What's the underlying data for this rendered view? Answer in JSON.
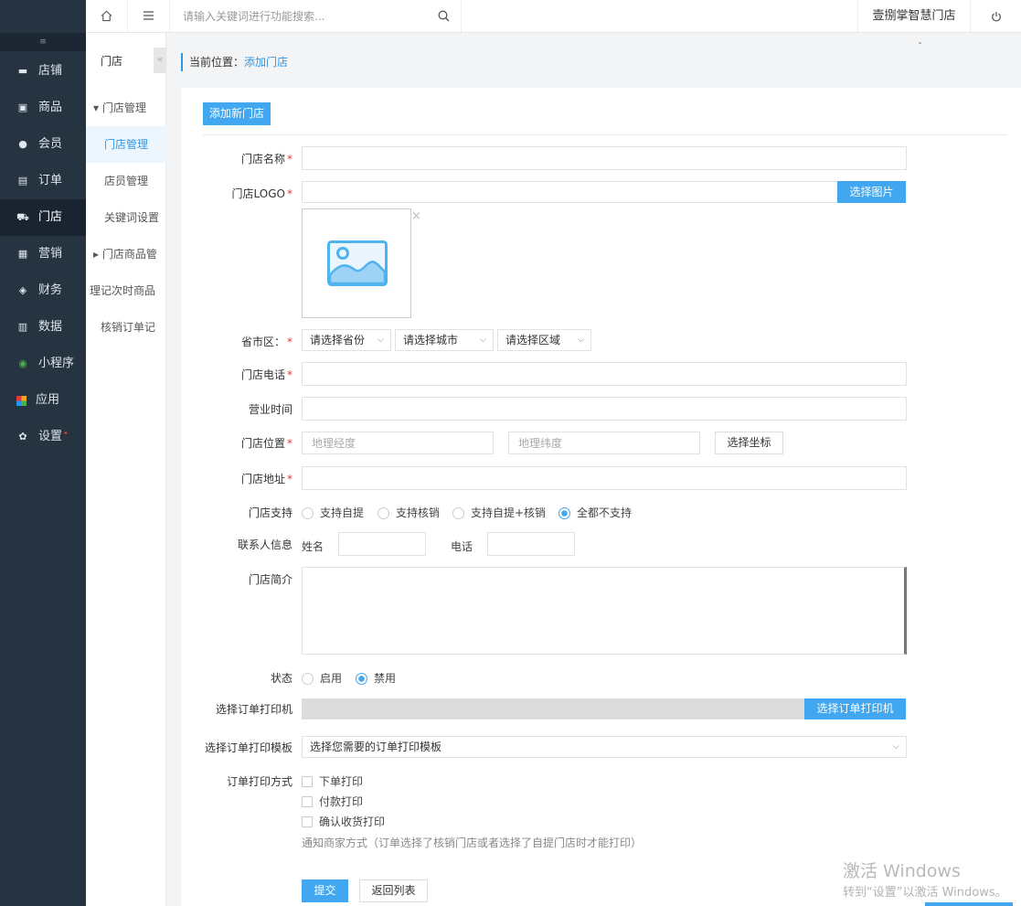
{
  "sidebar": {
    "collapse_icon": "collapse-icon",
    "items": [
      {
        "label": "店铺",
        "icon": "store-icon",
        "active": false
      },
      {
        "label": "商品",
        "icon": "goods-icon",
        "active": false
      },
      {
        "label": "会员",
        "icon": "member-icon",
        "active": false
      },
      {
        "label": "订单",
        "icon": "order-icon",
        "active": false
      },
      {
        "label": "门店",
        "icon": "shop-icon",
        "active": true
      },
      {
        "label": "营销",
        "icon": "gift-icon",
        "active": false
      },
      {
        "label": "财务",
        "icon": "money-bag-icon",
        "active": false
      },
      {
        "label": "数据",
        "icon": "bar-chart-icon",
        "active": false
      },
      {
        "label": "小程序",
        "icon": "miniprogram-icon",
        "active": false
      },
      {
        "label": "应用",
        "icon": "apps-icon",
        "active": false
      },
      {
        "label": "设置",
        "icon": "gear-icon",
        "active": false,
        "badge": "•"
      }
    ]
  },
  "topbar": {
    "search_placeholder": "请输入关键词进行功能搜索...",
    "store_name": "壹捌掌智慧门店"
  },
  "subnav": {
    "title": "门店",
    "items": [
      {
        "label": "▾ 门店管理",
        "active": false
      },
      {
        "label": "门店管理",
        "active": true
      },
      {
        "label": "店员管理",
        "active": false
      },
      {
        "label": "关键词设置",
        "active": false
      },
      {
        "label": "▸ 门店商品管",
        "active": false
      },
      {
        "label": "理记次时商品",
        "active": false
      },
      {
        "label": "核销订单记",
        "active": false
      }
    ]
  },
  "breadcrumb": {
    "prefix": "当前位置：",
    "current": "添加门店"
  },
  "form": {
    "add_button": "添加新门店",
    "name_label": "门店名称",
    "logo_label": "门店LOGO",
    "choose_image": "选择图片",
    "region_label": "省市区：",
    "province": "请选择省份",
    "city": "请选择城市",
    "district": "请选择区域",
    "phone_label": "门店电话",
    "hours_label": "营业时间",
    "location_label": "门店位置",
    "lng_placeholder": "地理经度",
    "lat_placeholder": "地理纬度",
    "choose_coord": "选择坐标",
    "address_label": "门店地址",
    "support_label": "门店支持",
    "support_options": [
      {
        "label": "支持自提",
        "checked": false
      },
      {
        "label": "支持核销",
        "checked": false
      },
      {
        "label": "支持自提+核销",
        "checked": false
      },
      {
        "label": "全都不支持",
        "checked": true
      }
    ],
    "contact_label": "联系人信息",
    "contact_name": "姓名",
    "contact_phone": "电话",
    "intro_label": "门店简介",
    "status_label": "状态",
    "status_options": [
      {
        "label": "启用",
        "checked": false
      },
      {
        "label": "禁用",
        "checked": true
      }
    ],
    "printer_label": "选择订单打印机",
    "choose_printer": "选择订单打印机",
    "template_label": "选择订单打印模板",
    "template_select": "选择您需要的订单打印模板",
    "print_mode_label": "订单打印方式",
    "print_modes": [
      "下单打印",
      "付款打印",
      "确认收货打印"
    ],
    "notify_text": "通知商家方式（订单选择了核销门店或者选择了自提门店时才能打印）",
    "submit": "提交",
    "back": "返回列表",
    "required_mark": "*"
  },
  "watermark": {
    "line1": "激活 Windows",
    "line2": "转到“设置”以激活 Windows。"
  }
}
